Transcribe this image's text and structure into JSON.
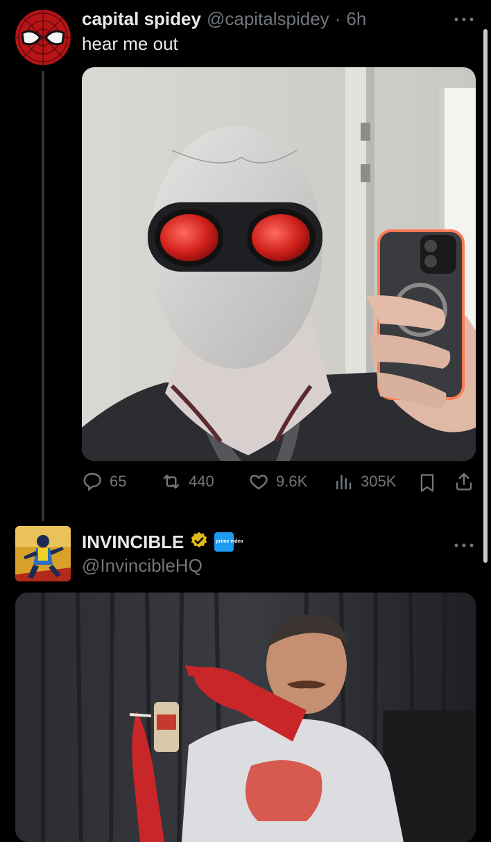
{
  "post1": {
    "display_name": "capital spidey",
    "handle": "@capitalspidey",
    "separator": "·",
    "time": "6h",
    "text": "hear me out",
    "actions": {
      "replies": "65",
      "reposts": "440",
      "likes": "9.6K",
      "views": "305K"
    }
  },
  "post2": {
    "display_name": "INVINCIBLE",
    "handle": "@InvincibleHQ",
    "affiliate_badge": "prime video"
  },
  "icons": {
    "more": "more-icon",
    "reply": "reply-icon",
    "repost": "repost-icon",
    "like": "like-icon",
    "views": "views-icon",
    "bookmark": "bookmark-icon",
    "share": "share-icon",
    "verified": "verified-badge-icon"
  },
  "colors": {
    "background": "#000000",
    "text_primary": "#e7e9ea",
    "text_secondary": "#71767b",
    "verified_gold": "#e2b719",
    "affiliate_blue": "#1d9bf0"
  }
}
